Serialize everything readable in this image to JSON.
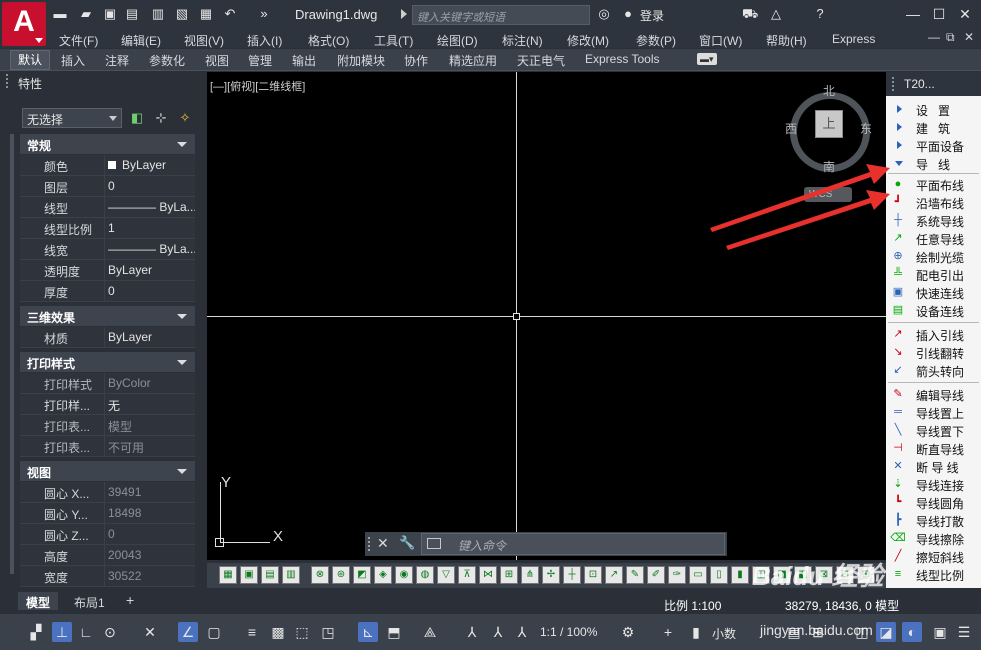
{
  "app": {
    "logo_letter": "A",
    "doc_title": "Drawing1.dwg",
    "search_placeholder": "键入关键字或短语",
    "login": "登录",
    "accent_color": "#c8102e"
  },
  "menu": [
    "文件(F)",
    "编辑(E)",
    "视图(V)",
    "插入(I)",
    "格式(O)",
    "工具(T)",
    "绘图(D)",
    "标注(N)",
    "修改(M)",
    "参数(P)",
    "窗口(W)",
    "帮助(H)",
    "Express"
  ],
  "ribbon_tabs": [
    "默认",
    "插入",
    "注释",
    "参数化",
    "视图",
    "管理",
    "输出",
    "附加模块",
    "协作",
    "精选应用",
    "天正电气",
    "Express Tools"
  ],
  "properties": {
    "title": "特性",
    "selection": "无选择",
    "general": {
      "title": "常规",
      "rows": [
        {
          "label": "颜色",
          "value": "ByLayer"
        },
        {
          "label": "图层",
          "value": "0"
        },
        {
          "label": "线型",
          "value": "———— ByLa..."
        },
        {
          "label": "线型比例",
          "value": "1"
        },
        {
          "label": "线宽",
          "value": "———— ByLa..."
        },
        {
          "label": "透明度",
          "value": "ByLayer"
        },
        {
          "label": "厚度",
          "value": "0"
        }
      ]
    },
    "three_d": {
      "title": "三维效果",
      "rows": [
        {
          "label": "材质",
          "value": "ByLayer"
        }
      ]
    },
    "plot_style": {
      "title": "打印样式",
      "rows": [
        {
          "label": "打印样式",
          "value": "ByColor"
        },
        {
          "label": "打印样...",
          "value": "无"
        },
        {
          "label": "打印表...",
          "value": "模型"
        },
        {
          "label": "打印表...",
          "value": "不可用"
        }
      ]
    },
    "view": {
      "title": "视图",
      "rows": [
        {
          "label": "圆心 X...",
          "value": "39491"
        },
        {
          "label": "圆心 Y...",
          "value": "18498"
        },
        {
          "label": "圆心 Z...",
          "value": "0"
        },
        {
          "label": "高度",
          "value": "20043"
        },
        {
          "label": "宽度",
          "value": "30522"
        }
      ]
    }
  },
  "canvas": {
    "view_label": "[—][俯视][二维线框]",
    "compass": {
      "north": "北",
      "south": "南",
      "east": "东",
      "west": "西",
      "cube": "上",
      "wcs": "WCS"
    },
    "ucs_x": "X",
    "ucs_y": "Y"
  },
  "command_line": {
    "placeholder": "键入命令"
  },
  "tpal": {
    "title": "T20...",
    "categories": [
      {
        "label": "设置",
        "open": false
      },
      {
        "label": "建筑",
        "open": false
      },
      {
        "label": "平面设备",
        "open": false
      },
      {
        "label": "导线",
        "open": true
      }
    ],
    "groups": [
      [
        "平面布线",
        "沿墙布线",
        "系统导线",
        "任意导线",
        "绘制光缆",
        "配电引出",
        "快速连线",
        "设备连线"
      ],
      [
        "插入引线",
        "引线翻转",
        "箭头转向"
      ],
      [
        "编辑导线",
        "导线置上",
        "导线置下",
        "断直导线",
        "断 导 线",
        "导线连接",
        "导线圆角",
        "导线打散",
        "导线擦除",
        "擦短斜线",
        "线型比例"
      ]
    ]
  },
  "layout_tabs": [
    "模型",
    "布局1"
  ],
  "status": {
    "scale": "比例 1:100",
    "coords": "38279, 18436, 0",
    "space": "模型",
    "annotation_scale": "1:1 / 100%",
    "units": "小数"
  },
  "watermark": {
    "brand": "Baidu 经验",
    "url": "jingyan.baidu.com"
  }
}
